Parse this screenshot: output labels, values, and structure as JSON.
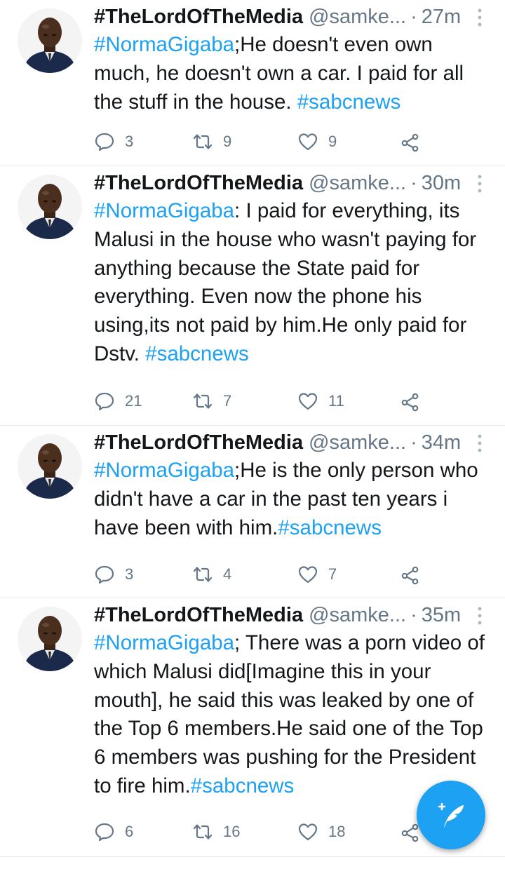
{
  "tweets": [
    {
      "author": "#TheLordOfTheMedia",
      "handle": "@samke...",
      "separator": "·",
      "time": "27m",
      "hashtag_lead": "#NormaGigaba",
      "body": ";He doesn't even own much, he doesn't own a car. I paid for all the stuff in the house. ",
      "hashtag_tail": "#sabcnews",
      "replies": "3",
      "retweets": "9",
      "likes": "9"
    },
    {
      "author": "#TheLordOfTheMedia",
      "handle": "@samke...",
      "separator": "·",
      "time": "30m",
      "hashtag_lead": "#NormaGigaba",
      "body": ": I paid for everything, its Malusi in the house who wasn't paying for anything because the State paid for everything. Even now the phone his using,its not paid by him.He only paid for Dstv. ",
      "hashtag_tail": "#sabcnews",
      "replies": "21",
      "retweets": "7",
      "likes": "11"
    },
    {
      "author": "#TheLordOfTheMedia",
      "handle": "@samke...",
      "separator": "·",
      "time": "34m",
      "hashtag_lead": "#NormaGigaba",
      "body": ";He is the only person who didn't have a car in the past ten years i have been with him.",
      "hashtag_tail": "#sabcnews",
      "replies": "3",
      "retweets": "4",
      "likes": "7"
    },
    {
      "author": "#TheLordOfTheMedia",
      "handle": "@samke...",
      "separator": "·",
      "time": "35m",
      "hashtag_lead": "#NormaGigaba",
      "body": "; There was a porn video of which Malusi did[Imagine this in your mouth], he said this was leaked by one of the Top 6 members.He said one of the Top 6 members was pushing for the President to fire him.",
      "hashtag_tail": "#sabcnews",
      "replies": "6",
      "retweets": "16",
      "likes": "18"
    }
  ],
  "icons": {
    "reply": "reply-icon",
    "retweet": "retweet-icon",
    "like": "heart-icon",
    "share": "share-icon",
    "more": "more-vertical-icon",
    "compose": "compose-tweet-icon"
  },
  "colors": {
    "accent": "#1da1f2",
    "text": "#14171a",
    "secondary": "#657786",
    "divider": "#e1e8ed"
  }
}
